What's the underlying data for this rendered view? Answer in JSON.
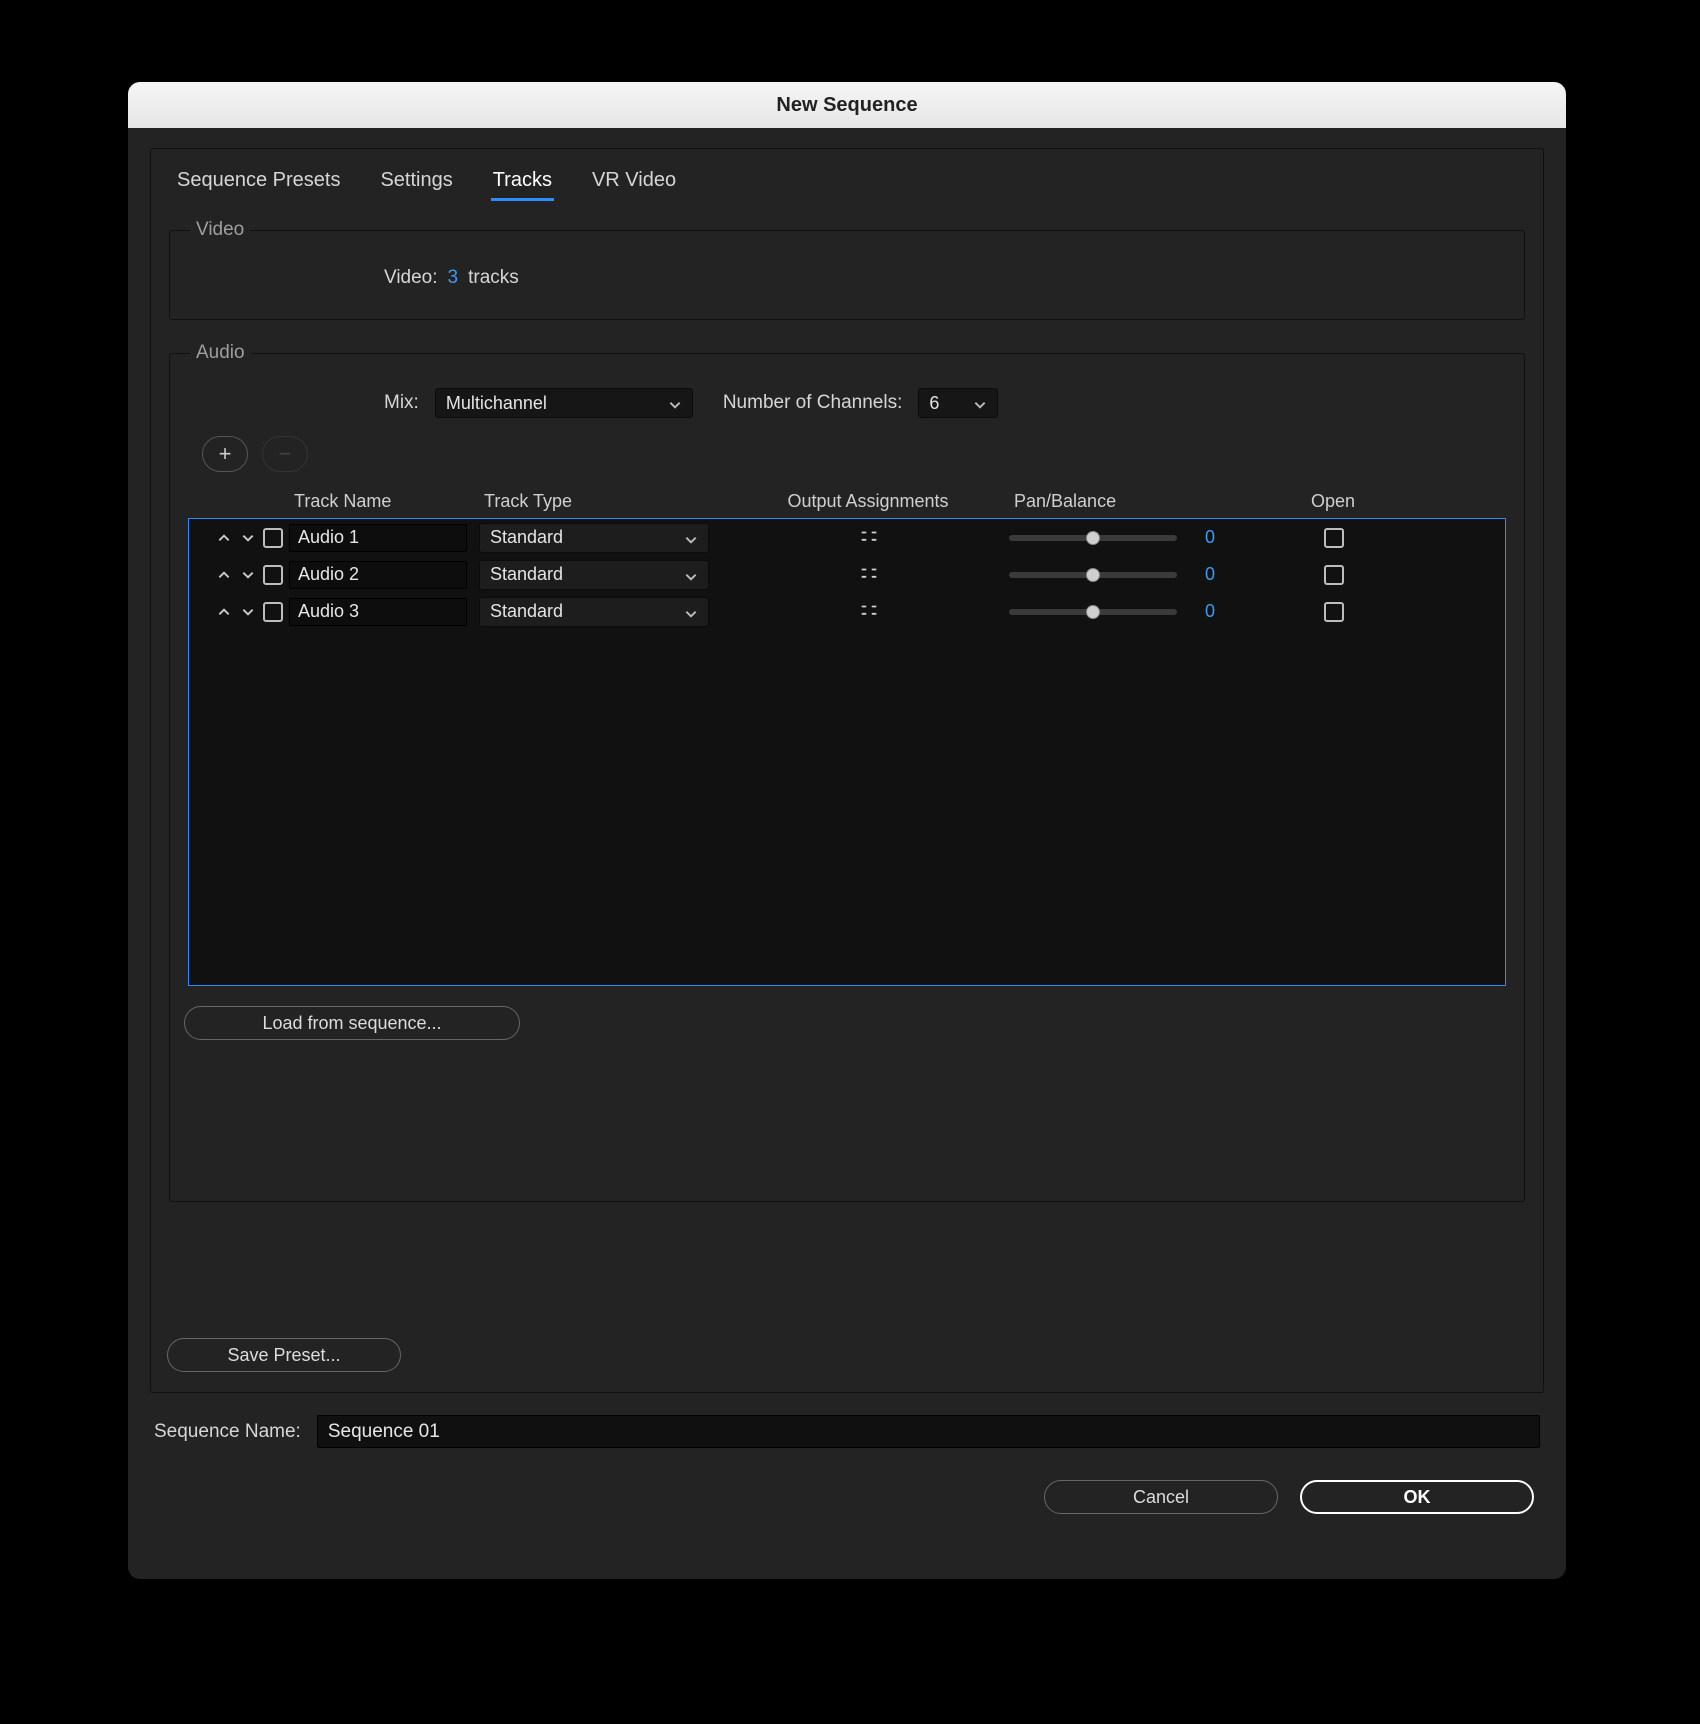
{
  "dialog": {
    "title": "New Sequence"
  },
  "tabs": {
    "items": [
      "Sequence Presets",
      "Settings",
      "Tracks",
      "VR Video"
    ],
    "active_index": 2
  },
  "video": {
    "legend": "Video",
    "label": "Video:",
    "count": "3",
    "suffix": "tracks"
  },
  "audio": {
    "legend": "Audio",
    "mix_label": "Mix:",
    "mix_value": "Multichannel",
    "channels_label": "Number of Channels:",
    "channels_value": "6",
    "add_label": "+",
    "remove_label": "−",
    "columns": {
      "track_name": "Track Name",
      "track_type": "Track Type",
      "output": "Output Assignments",
      "pan": "Pan/Balance",
      "open": "Open"
    },
    "rows": [
      {
        "name": "Audio 1",
        "type": "Standard",
        "pan": "0",
        "open": false
      },
      {
        "name": "Audio 2",
        "type": "Standard",
        "pan": "0",
        "open": false
      },
      {
        "name": "Audio 3",
        "type": "Standard",
        "pan": "0",
        "open": false
      }
    ],
    "load_button": "Load from sequence..."
  },
  "save_preset_label": "Save Preset...",
  "sequence_name": {
    "label": "Sequence Name:",
    "value": "Sequence 01"
  },
  "actions": {
    "cancel": "Cancel",
    "ok": "OK"
  },
  "colors": {
    "accent": "#2b8cff",
    "link_blue": "#3a9af5"
  }
}
